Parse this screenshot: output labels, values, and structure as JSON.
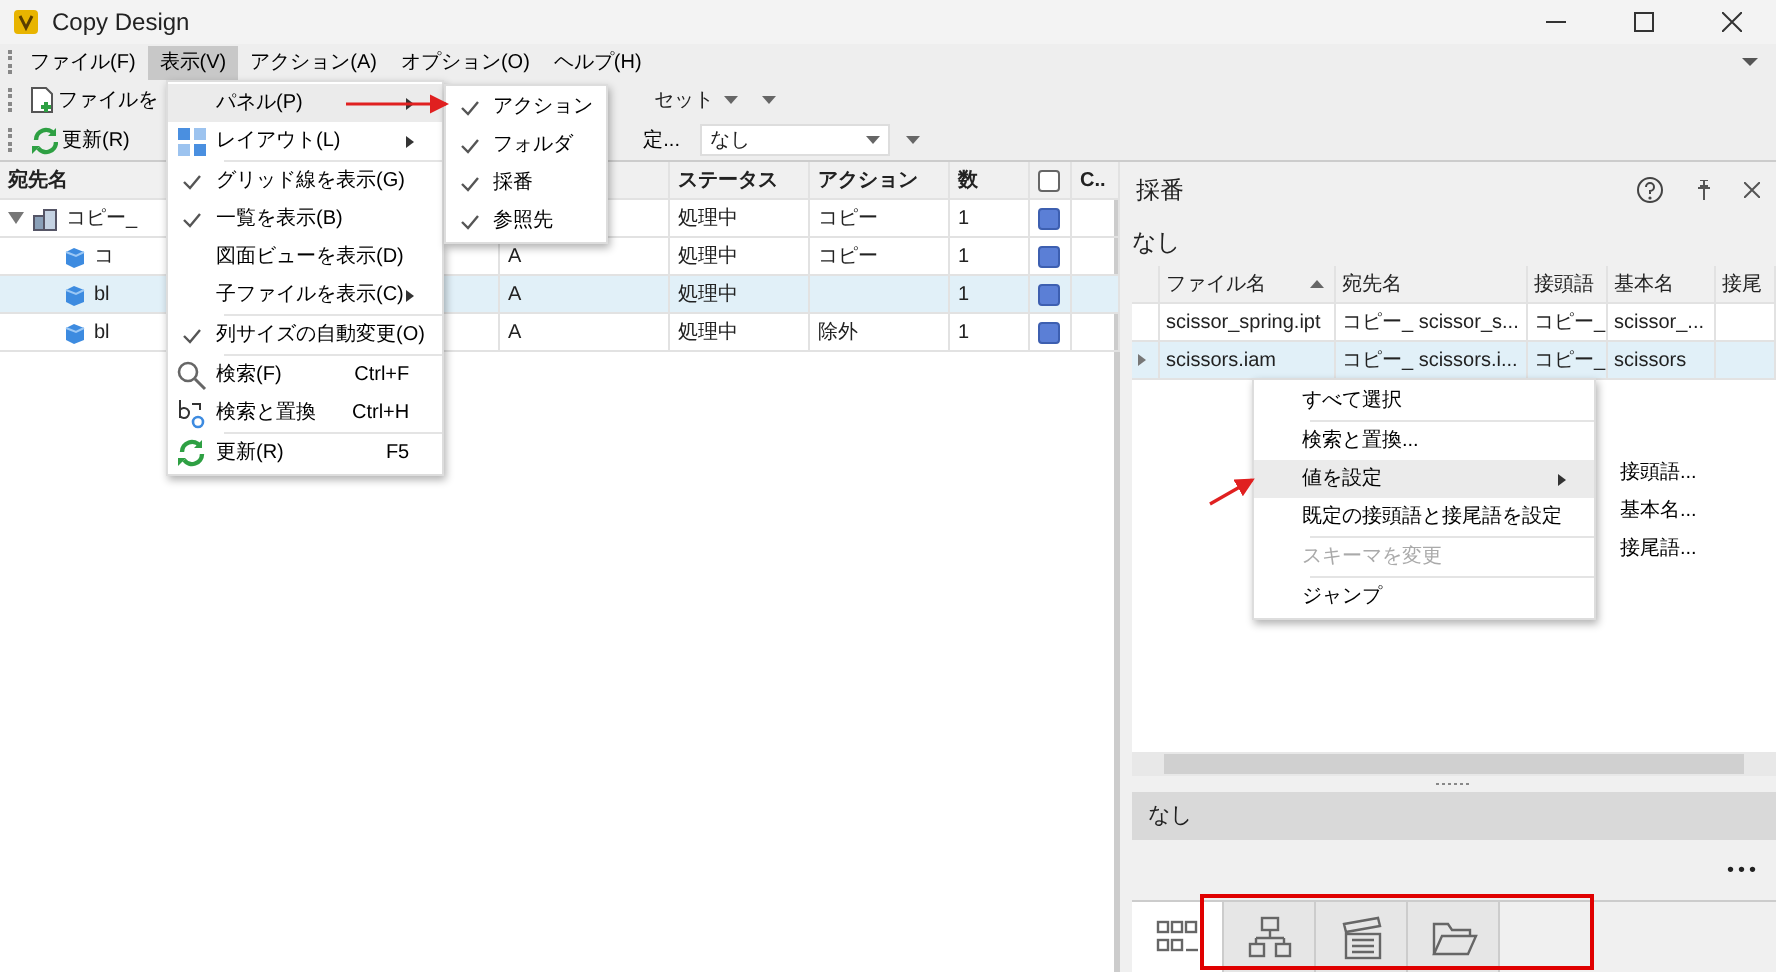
{
  "window": {
    "title": "Copy Design"
  },
  "menubar": [
    {
      "label": "ファイル(F)",
      "selected": false
    },
    {
      "label": "表示(V)",
      "selected": true
    },
    {
      "label": "アクション(A)",
      "selected": false
    },
    {
      "label": "オプション(O)",
      "selected": false
    },
    {
      "label": "ヘルプ(H)",
      "selected": false
    }
  ],
  "toolbar_1": {
    "add_file": "ファイルを",
    "preset": "セット"
  },
  "toolbar_2": {
    "refresh": "更新(R)",
    "settings": "定...",
    "filter": "なし"
  },
  "table": {
    "columns": {
      "name": "宛先名",
      "status": "ステータス",
      "action": "アクション",
      "count": "数",
      "check_all": false,
      "extra": "C.."
    },
    "rows": [
      {
        "name": "コピー_",
        "kind": "assembly",
        "expanded": true,
        "status": "処理中",
        "action": "コピー",
        "count": "1",
        "selected": false,
        "children": [
          {
            "name": "コ",
            "kind": "part",
            "revision": "A",
            "status": "処理中",
            "action": "コピー",
            "count": "1",
            "selected": false
          },
          {
            "name": "bl",
            "kind": "part",
            "revision": "A",
            "status": "処理中",
            "count": "1",
            "selected": true
          },
          {
            "name": "bl",
            "kind": "part",
            "revision": "A",
            "status": "処理中",
            "action": "除外",
            "count": "1",
            "selected": false
          }
        ]
      }
    ]
  },
  "view_menu": [
    {
      "label": "パネル(P)",
      "kind": "plain",
      "submenu": true,
      "highlighted": true,
      "checked": false
    },
    {
      "label": "レイアウト(L)",
      "kind": "layout",
      "submenu": true,
      "highlighted": false,
      "checked": false
    },
    {
      "label": "グリッド線を表示(G)",
      "kind": "plain",
      "separator_before": true,
      "highlighted": false,
      "checked": true
    },
    {
      "label": "一覧を表示(B)",
      "kind": "plain",
      "highlighted": false,
      "checked": true
    },
    {
      "label": "図面ビューを表示(D)",
      "kind": "plain",
      "highlighted": false,
      "checked": false
    },
    {
      "label": "子ファイルを表示(C)",
      "kind": "plain",
      "submenu": true,
      "highlighted": false,
      "checked": false
    },
    {
      "label": "列サイズの自動変更(O)",
      "kind": "plain",
      "separator_before": true,
      "highlighted": false,
      "checked": true
    },
    {
      "label": "検索(F)",
      "kind": "search",
      "separator_before": true,
      "shortcut": "Ctrl+F",
      "highlighted": false,
      "checked": false
    },
    {
      "label": "検索と置換",
      "kind": "replace",
      "shortcut": "Ctrl+H",
      "highlighted": false,
      "checked": false
    },
    {
      "label": "更新(R)",
      "kind": "refresh",
      "separator_before": true,
      "shortcut": "F5",
      "highlighted": false,
      "checked": false
    }
  ],
  "panel_submenu": [
    {
      "label": "アクション",
      "checked": true
    },
    {
      "label": "フォルダ",
      "checked": true
    },
    {
      "label": "採番",
      "checked": true
    },
    {
      "label": "参照先",
      "checked": true
    }
  ],
  "numbering_panel": {
    "title": "採番",
    "filter": "なし",
    "columns": [
      {
        "label": "ファイル名",
        "sorted": true
      },
      {
        "label": "宛先名",
        "sorted": false
      },
      {
        "label": "接頭語",
        "sorted": false
      },
      {
        "label": "基本名",
        "sorted": false
      },
      {
        "label": "接尾",
        "sorted": false
      }
    ],
    "rows": [
      {
        "cells": [
          "scissor_spring.ipt",
          "コピー_ scissor_s...",
          "コピー_",
          "scissor_..."
        ],
        "selected": false,
        "current": false
      },
      {
        "cells": [
          "scissors.iam",
          "コピー_ scissors.i...",
          "コピー_",
          "scissors"
        ],
        "selected": true,
        "current": true
      }
    ],
    "context_menu": [
      {
        "label": "すべて選択",
        "disabled": false,
        "highlighted": false
      },
      {
        "label": "検索と置換...",
        "separator_before": true,
        "disabled": false,
        "highlighted": false
      },
      {
        "label": "値を設定",
        "submenu": true,
        "disabled": false,
        "highlighted": true
      },
      {
        "label": "既定の接頭語と接尾語を設定",
        "disabled": false,
        "highlighted": false
      },
      {
        "label": "スキーマを変更",
        "separator_before": true,
        "disabled": true,
        "highlighted": false
      },
      {
        "label": "ジャンプ",
        "separator_before": true,
        "disabled": false,
        "highlighted": false
      }
    ],
    "value_submenu": [
      "接頭語...",
      "基本名...",
      "接尾語..."
    ],
    "status": "なし",
    "more": "•••",
    "tabs": [
      {
        "kind": "grid",
        "selected": true
      },
      {
        "kind": "tree",
        "selected": false
      },
      {
        "kind": "clapper",
        "selected": false
      },
      {
        "kind": "folder",
        "selected": false
      }
    ]
  }
}
